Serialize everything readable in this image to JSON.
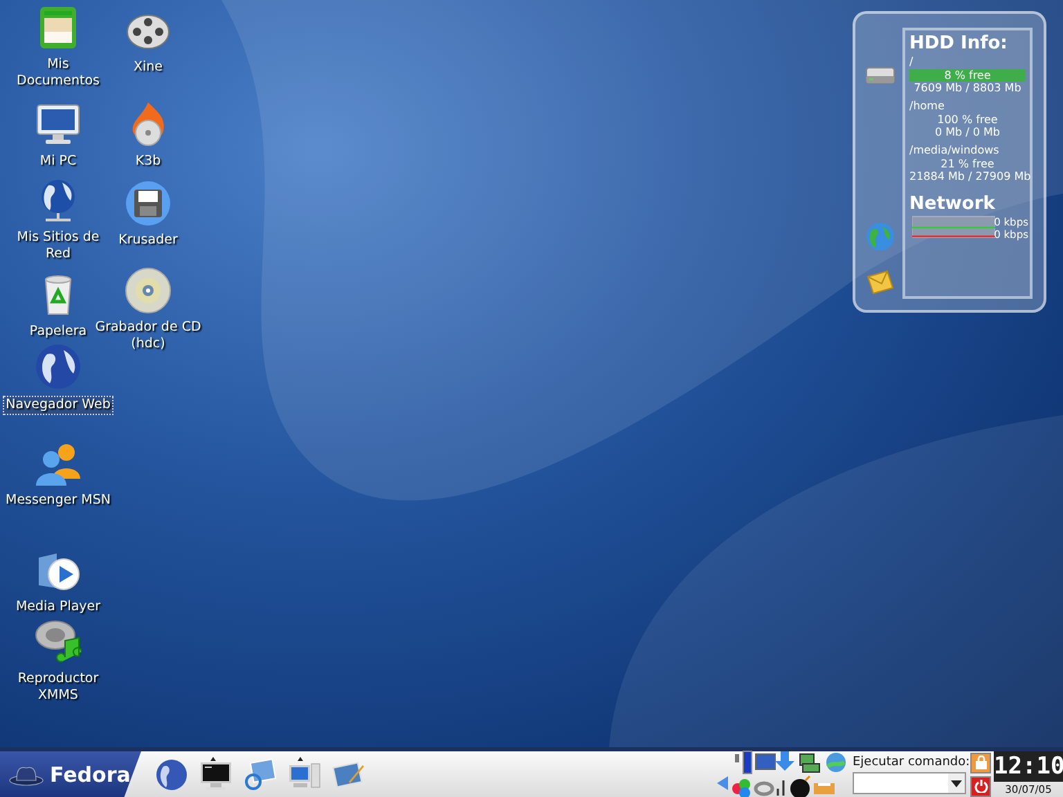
{
  "desktop_icons": [
    {
      "label": "Mis Documentos",
      "kind": "documents",
      "selected": false
    },
    {
      "label": "Xine",
      "kind": "film",
      "selected": false
    },
    {
      "label": "Mi PC",
      "kind": "monitor",
      "selected": false
    },
    {
      "label": "K3b",
      "kind": "burn",
      "selected": false
    },
    {
      "label": "Mis Sitios de Red",
      "kind": "network",
      "selected": false
    },
    {
      "label": "Krusader",
      "kind": "floppy",
      "selected": false
    },
    {
      "label": "Papelera",
      "kind": "trash",
      "selected": false
    },
    {
      "label": "Grabador de CD (hdc)",
      "kind": "cd",
      "selected": false
    },
    {
      "label": "Navegador Web",
      "kind": "globe",
      "selected": true
    },
    {
      "label": "Messenger MSN",
      "kind": "people",
      "selected": false
    },
    {
      "label": "Media Player",
      "kind": "play",
      "selected": false
    },
    {
      "label": "Reproductor XMMS",
      "kind": "music",
      "selected": false
    }
  ],
  "widget": {
    "hdd_title": "HDD Info:",
    "drives": [
      {
        "mount": "/",
        "free": "8 % free",
        "highlighted": true,
        "usage": "7609 Mb / 8803 Mb"
      },
      {
        "mount": "/home",
        "free": "100 % free",
        "highlighted": false,
        "usage": "0 Mb / 0 Mb"
      },
      {
        "mount": "/media/windows",
        "free": "21 % free",
        "highlighted": false,
        "usage": "21884 Mb / 27909 Mb"
      }
    ],
    "network_title": "Network",
    "readings": [
      "0 kbps",
      "0 kbps"
    ]
  },
  "taskbar": {
    "start_label": "Fedora",
    "command_label": "Ejecutar comando:",
    "clock": "12:10",
    "date": "30/07/05"
  }
}
